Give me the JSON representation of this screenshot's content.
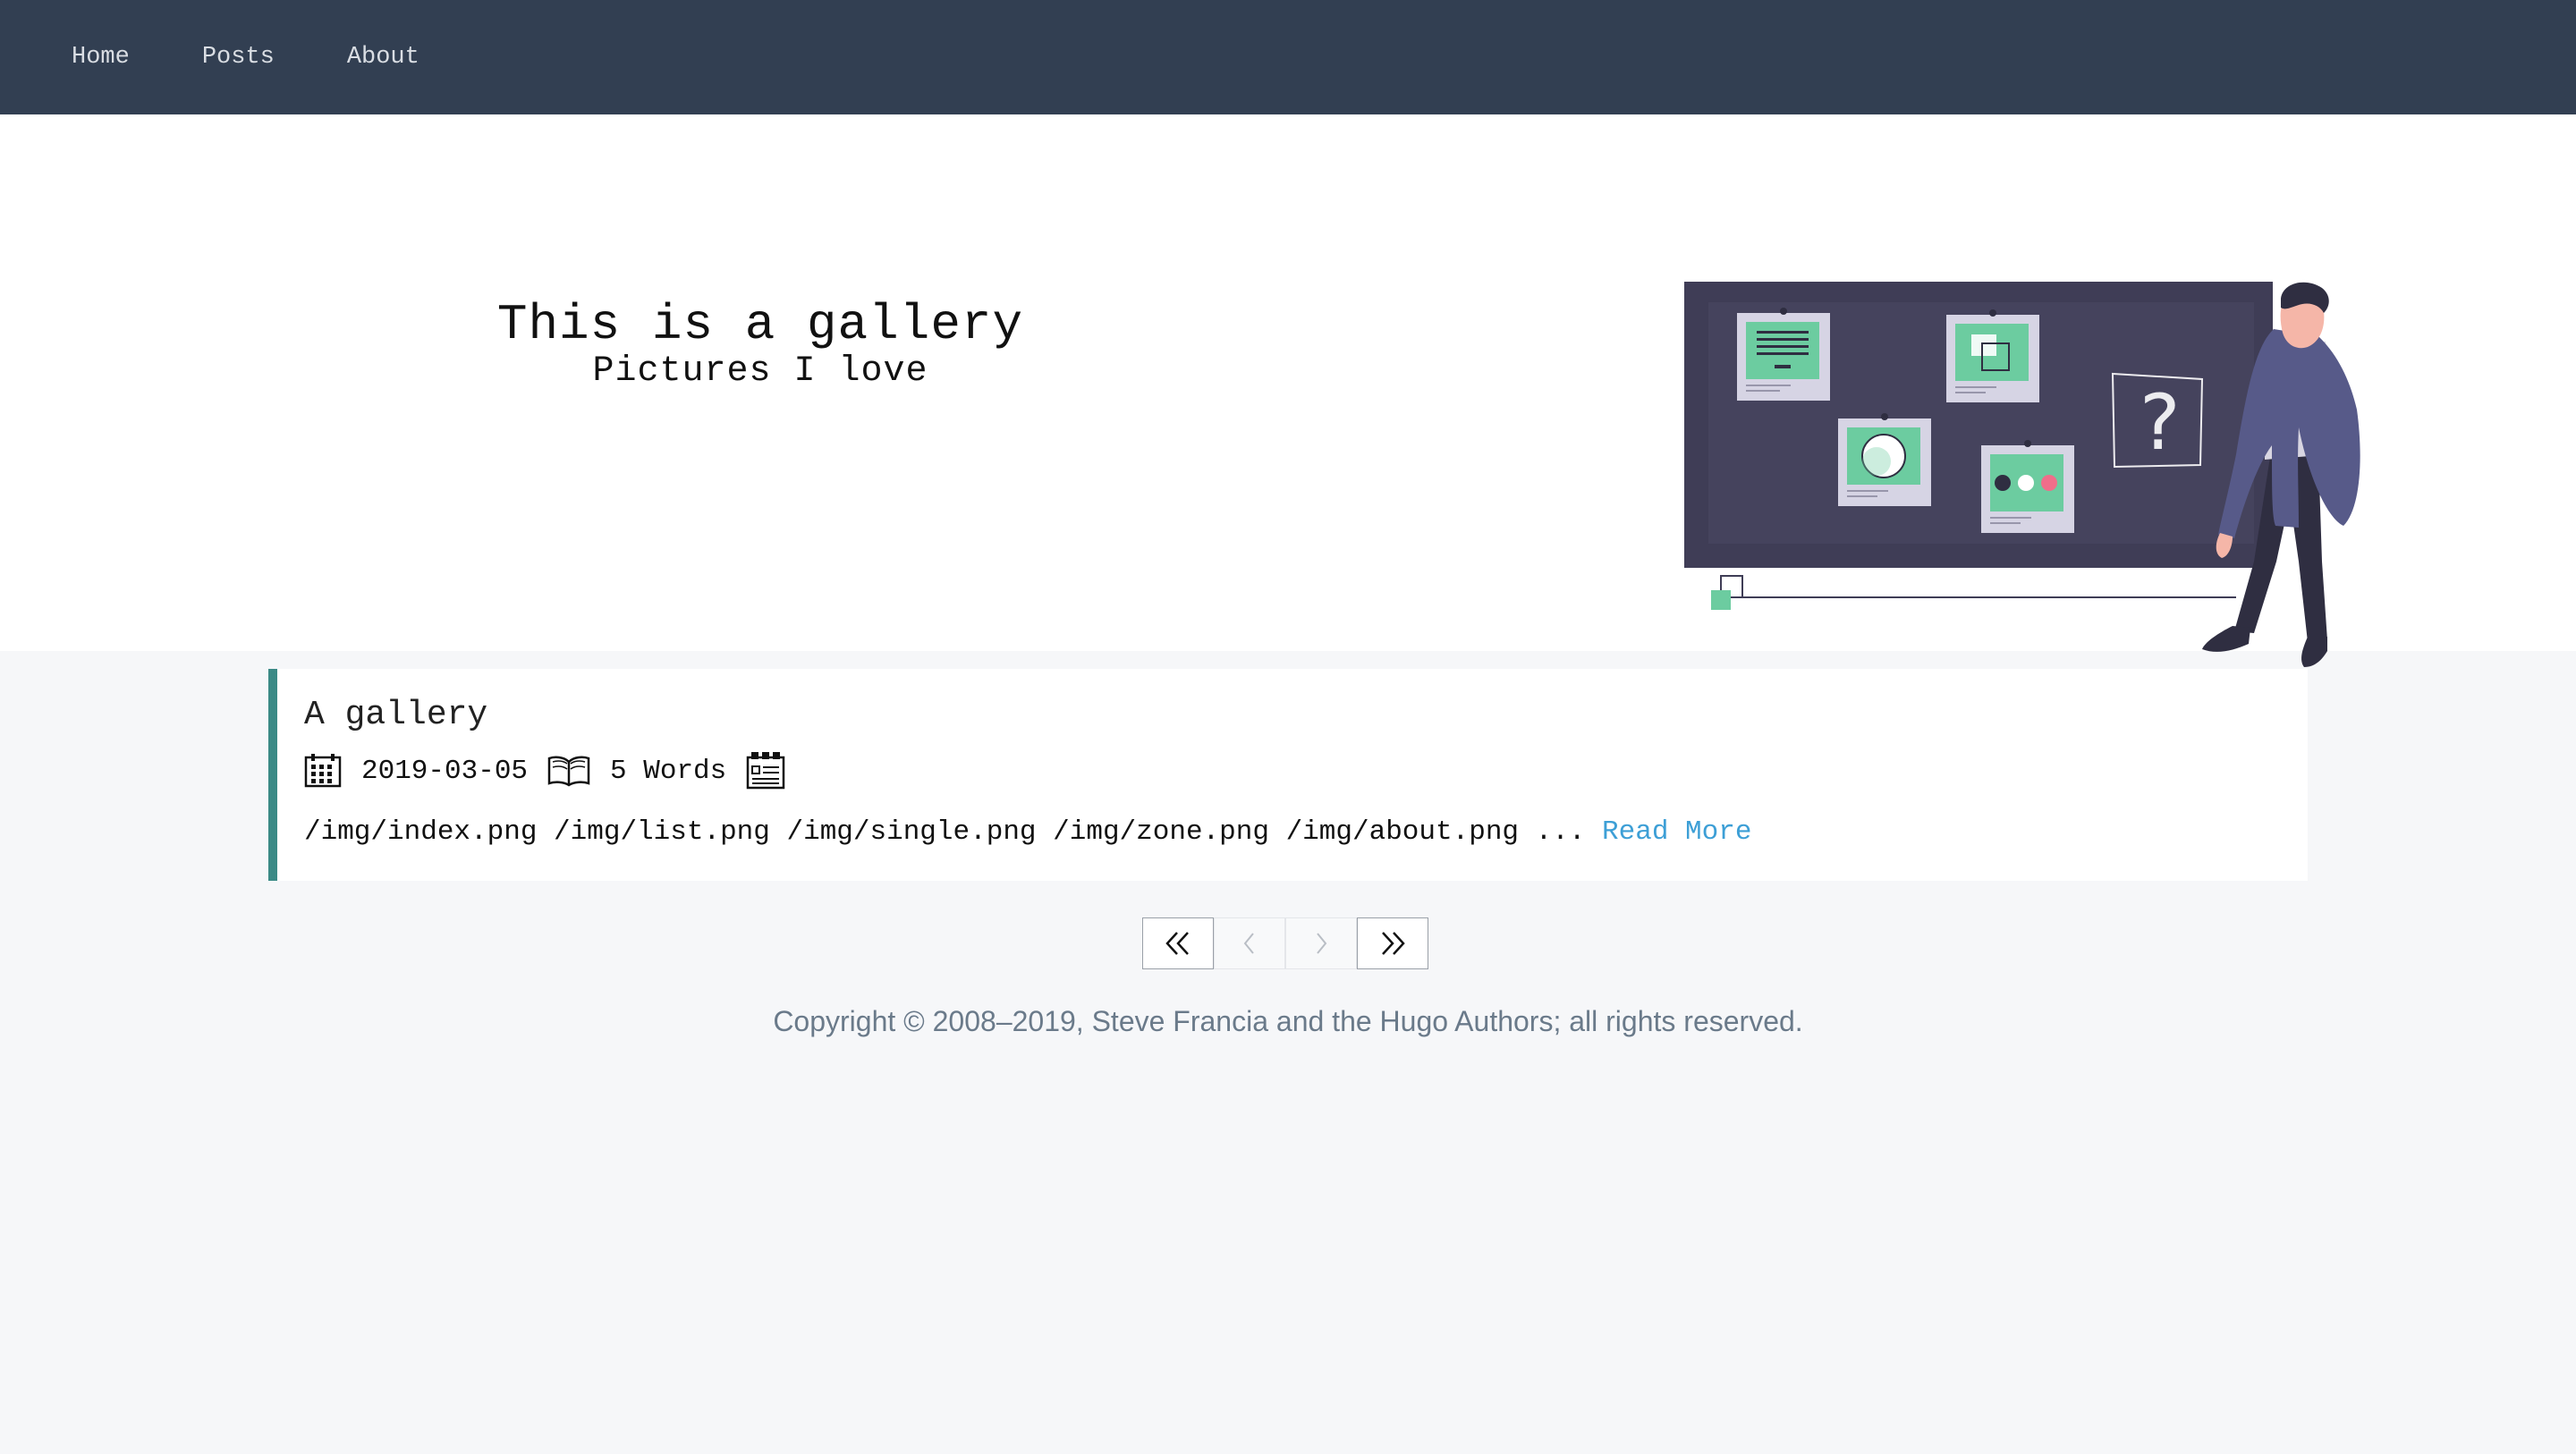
{
  "nav": {
    "items": [
      "Home",
      "Posts",
      "About"
    ]
  },
  "hero": {
    "title": "This is a gallery",
    "subtitle": "Pictures I love"
  },
  "post": {
    "title": "A gallery",
    "date": "2019-03-05",
    "words": "5 Words",
    "excerpt": "/img/index.png /img/list.png /img/single.png /img/zone.png /img/about.png ... ",
    "read_more": "Read More",
    "icons": [
      "calendar-icon",
      "book-icon",
      "category-icon"
    ]
  },
  "pagination": {
    "buttons": [
      "first-page",
      "previous-page",
      "next-page",
      "last-page"
    ]
  },
  "footer": {
    "copyright": "Copyright © 2008–2019, Steve Francia and the Hugo Authors; all rights reserved."
  },
  "colors": {
    "nav_bg": "#323f52",
    "accent_border": "#3b8a86",
    "link": "#3d9fd6",
    "board": "#3f3d56",
    "mint": "#6ccca0"
  }
}
